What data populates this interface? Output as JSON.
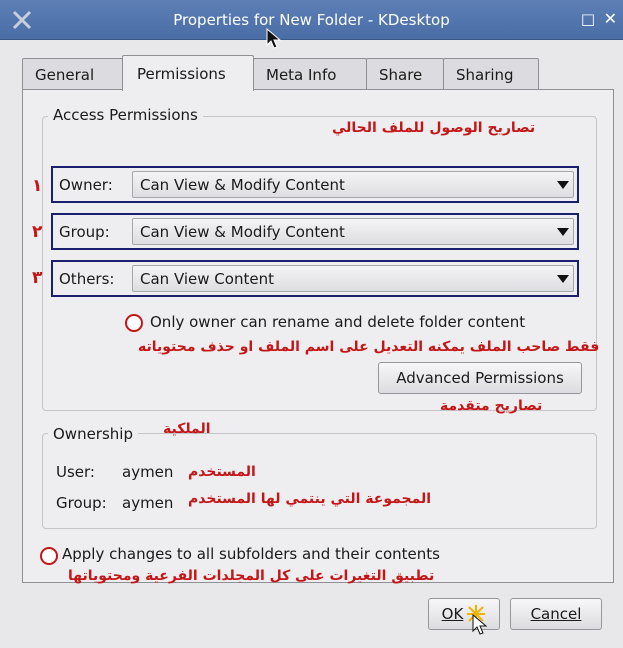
{
  "window": {
    "title": "Properties for New Folder - KDesktop",
    "maximize_glyph": "□",
    "close_glyph": "✕"
  },
  "tabs": [
    {
      "label": "General",
      "active": false
    },
    {
      "label": "Permissions",
      "active": true
    },
    {
      "label": "Meta Info",
      "active": false
    },
    {
      "label": "Share",
      "active": false
    },
    {
      "label": "Sharing",
      "active": false
    }
  ],
  "access": {
    "group_title": "Access Permissions",
    "annotation": "تصاريح الوصول للملف الحالي",
    "rows": [
      {
        "number": "١",
        "label": "Owner:",
        "value": "Can View & Modify Content"
      },
      {
        "number": "٢",
        "label": "Group:",
        "value": "Can View & Modify Content"
      },
      {
        "number": "٣",
        "label": "Others:",
        "value": "Can View Content"
      }
    ],
    "only_owner_label": "Only owner can rename and delete folder content",
    "only_owner_annotation": "فقط صاحب الملف يمكنه التعديل على اسم الملف او حذف محتوياته",
    "advanced_button": "Advanced Permissions",
    "advanced_annotation": "تصاريح متقدمة"
  },
  "ownership": {
    "group_title": "Ownership",
    "annotation": "الملكية",
    "user_label": "User:",
    "user_value": "aymen",
    "user_annotation": "المستخدم",
    "group_label": "Group:",
    "group_value": "aymen",
    "group_annotation": "المجموعة التي ينتمي لها المستخدم"
  },
  "apply": {
    "label": "Apply changes to all subfolders and their contents",
    "annotation": "تطبيق التغيرات على كل المجلدات الفرعية ومحتوياتها"
  },
  "buttons": {
    "ok": "OK",
    "cancel": "Cancel"
  },
  "colors": {
    "titlebar": "#5272ab",
    "annotation": "#c41616",
    "highlight_border": "#1a1f6e"
  }
}
